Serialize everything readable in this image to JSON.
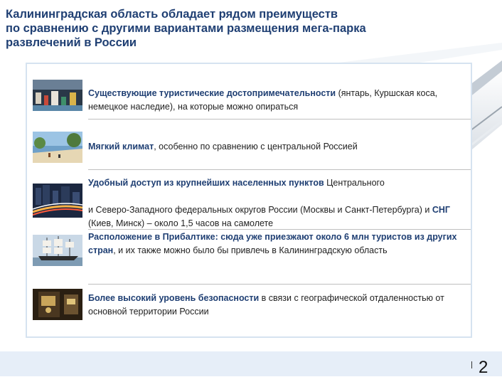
{
  "slide": {
    "title_lines": [
      "Калининградская область обладает рядом преимуществ",
      "по сравнению с другими вариантами размещения мега-парка",
      "развлечений в России"
    ],
    "page_number": "2"
  },
  "advantages": [
    {
      "image": "yacht-harbor-photo",
      "bold": "Существующие туристические достопримечательности",
      "text": " (янтарь, Куршская коса, немецкое наследие), на которые можно опираться"
    },
    {
      "image": "beach-photo",
      "bold": "Мягкий климат",
      "text": ", особенно по сравнению с центральной Россией"
    },
    {
      "image": "city-highway-photo",
      "bold": "Удобный доступ из крупнейших населенных пунктов",
      "text": " Центрального",
      "line2": "и Северо-Западного федеральных округов России (Москвы и Санкт-Петербурга) и ",
      "bold2": "СНГ",
      "text2": " (Киев, Минск) – около 1,5 часов на самолете"
    },
    {
      "image": "sailing-ship-photo",
      "bold": "Расположение в Прибалтике: сюда уже приезжают около 6 млн туристов из других стран",
      "text": ", и их также можно было бы привлечь в Калининградскую область"
    },
    {
      "image": "security-lock-photo",
      "bold": "Более высокий уровень безопасности",
      "text": " в связи с географической отдаленностью от основной территории России"
    }
  ]
}
